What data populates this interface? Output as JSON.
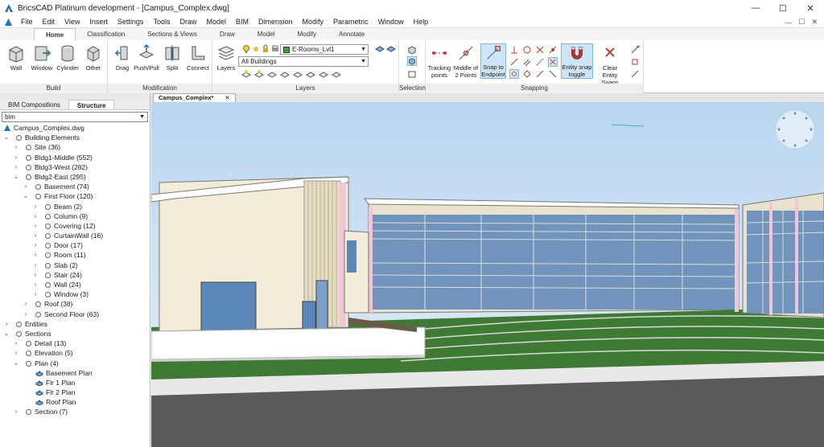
{
  "window": {
    "title": "BricsCAD Platinum development - [Campus_Complex.dwg]",
    "controls": [
      "—",
      "☐",
      "✕"
    ]
  },
  "menu": {
    "items": [
      "File",
      "Edit",
      "View",
      "Insert",
      "Settings",
      "Tools",
      "Draw",
      "Model",
      "BIM",
      "Dimension",
      "Modify",
      "Parametric",
      "Window",
      "Help"
    ],
    "right": [
      "—",
      "☐",
      "✕"
    ]
  },
  "ribbon_tabs": [
    "Home",
    "Classification",
    "Sections & Views",
    "Draw",
    "Model",
    "Modify",
    "Annotate"
  ],
  "ribbon": {
    "build": {
      "title": "Build",
      "tools": [
        "Wall",
        "Window",
        "Cylinder",
        "Other"
      ]
    },
    "modification": {
      "title": "Modification",
      "tools": [
        "Drag",
        "Push/Pull",
        "Split",
        "Connect"
      ]
    },
    "layers": {
      "title": "Layers",
      "button": "Layers",
      "layer_combo": "E-Rooms_Lvl1",
      "filter_combo": "All Buildings"
    },
    "selection": {
      "title": "Selection"
    },
    "snapping": {
      "title": "Snapping",
      "tools": [
        "Tracking points",
        "Middle of 2 Points",
        "Snap to Endpoint",
        "Entity snap toggle",
        "Clear Entity Snaps"
      ]
    }
  },
  "left_panel": {
    "tabs": [
      "BIM Compositions",
      "Structure"
    ],
    "filter": "bim",
    "tree": [
      {
        "label": "Campus_Complex.dwg",
        "level": 0,
        "exp": "",
        "kind": "file"
      },
      {
        "label": "Building Elements",
        "level": 0,
        "exp": "v",
        "kind": "node"
      },
      {
        "label": "Site (36)",
        "level": 1,
        "exp": ">",
        "kind": "node"
      },
      {
        "label": "Bldg1-Middle (552)",
        "level": 1,
        "exp": ">",
        "kind": "node"
      },
      {
        "label": "Bldg3-West (282)",
        "level": 1,
        "exp": ">",
        "kind": "node"
      },
      {
        "label": "Bldg2-East (295)",
        "level": 1,
        "exp": "v",
        "kind": "node"
      },
      {
        "label": "Basement (74)",
        "level": 2,
        "exp": ">",
        "kind": "node"
      },
      {
        "label": "First Floor (120)",
        "level": 2,
        "exp": "v",
        "kind": "node"
      },
      {
        "label": "Beam (2)",
        "level": 3,
        "exp": ">",
        "kind": "node"
      },
      {
        "label": "Column (9)",
        "level": 3,
        "exp": ">",
        "kind": "node"
      },
      {
        "label": "Covering (12)",
        "level": 3,
        "exp": ">",
        "kind": "node"
      },
      {
        "label": "CurtainWall (16)",
        "level": 3,
        "exp": ">",
        "kind": "node"
      },
      {
        "label": "Door (17)",
        "level": 3,
        "exp": ">",
        "kind": "node"
      },
      {
        "label": "Room (11)",
        "level": 3,
        "exp": ">",
        "kind": "node"
      },
      {
        "label": "Slab (2)",
        "level": 3,
        "exp": ">",
        "kind": "node"
      },
      {
        "label": "Stair (24)",
        "level": 3,
        "exp": ">",
        "kind": "node"
      },
      {
        "label": "Wall (24)",
        "level": 3,
        "exp": ">",
        "kind": "node"
      },
      {
        "label": "Window (3)",
        "level": 3,
        "exp": ">",
        "kind": "node"
      },
      {
        "label": "Roof (38)",
        "level": 2,
        "exp": ">",
        "kind": "node"
      },
      {
        "label": "Second Floor (63)",
        "level": 2,
        "exp": ">",
        "kind": "node"
      },
      {
        "label": "Entities",
        "level": 0,
        "exp": ">",
        "kind": "node"
      },
      {
        "label": "Sections",
        "level": 0,
        "exp": "v",
        "kind": "node"
      },
      {
        "label": "Detail (13)",
        "level": 1,
        "exp": ">",
        "kind": "node"
      },
      {
        "label": "Elevation (5)",
        "level": 1,
        "exp": ">",
        "kind": "node"
      },
      {
        "label": "Plan (4)",
        "level": 1,
        "exp": "v",
        "kind": "node"
      },
      {
        "label": "Basement Plan",
        "level": 2,
        "exp": "",
        "kind": "plan"
      },
      {
        "label": "Flr 1 Plan",
        "level": 2,
        "exp": "",
        "kind": "plan"
      },
      {
        "label": "Flr 2 Plan",
        "level": 2,
        "exp": "",
        "kind": "plan"
      },
      {
        "label": "Roof Plan",
        "level": 2,
        "exp": "",
        "kind": "plan"
      },
      {
        "label": "Section (7)",
        "level": 1,
        "exp": ">",
        "kind": "node"
      }
    ]
  },
  "document_tab": {
    "label": "Campus_Complex*",
    "close": "✕"
  },
  "colors": {
    "accent": "#1e73be",
    "sky": "#cfe3f5",
    "grass": "#3f7a35",
    "road": "#5a5a5a",
    "glass": "#5b86b8",
    "wall": "#f3ecd7"
  }
}
